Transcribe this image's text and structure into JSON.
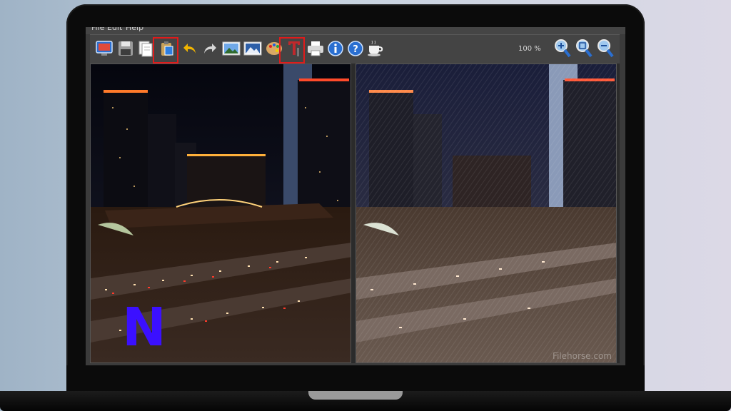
{
  "menu": {
    "file": "File",
    "edit": "Edit",
    "help": "Help"
  },
  "toolbar": {
    "buttons": [
      {
        "name": "open",
        "icon": "monitor-icon"
      },
      {
        "name": "save",
        "icon": "floppy-disk-icon"
      },
      {
        "name": "copy",
        "icon": "copy-icon"
      },
      {
        "name": "paste",
        "icon": "clipboard-icon",
        "highlighted": true
      },
      {
        "name": "undo",
        "icon": "undo-icon"
      },
      {
        "name": "redo",
        "icon": "redo-icon"
      },
      {
        "name": "original-image",
        "icon": "landscape-icon"
      },
      {
        "name": "processed-image",
        "icon": "landscape-icon"
      },
      {
        "name": "palette",
        "icon": "palette-icon"
      },
      {
        "name": "text",
        "icon": "text-tool-icon",
        "highlighted": true
      },
      {
        "name": "print",
        "icon": "printer-icon"
      },
      {
        "name": "info",
        "icon": "info-icon"
      },
      {
        "name": "help",
        "icon": "help-icon"
      },
      {
        "name": "donate",
        "icon": "coffee-cup-icon"
      },
      {
        "name": "zoom-in",
        "icon": "zoom-in-icon"
      },
      {
        "name": "zoom-fit",
        "icon": "zoom-fit-icon"
      },
      {
        "name": "zoom-out",
        "icon": "zoom-out-icon"
      }
    ],
    "zoom_level": "100 %"
  },
  "panes": {
    "left": {
      "description": "original night city photo"
    },
    "right": {
      "description": "artistic filtered night city photo",
      "watermark": "Filehorse.com"
    }
  },
  "overlay": {
    "letter": "N",
    "color": "#3b10ff"
  },
  "highlight_color": "#e01b1b"
}
